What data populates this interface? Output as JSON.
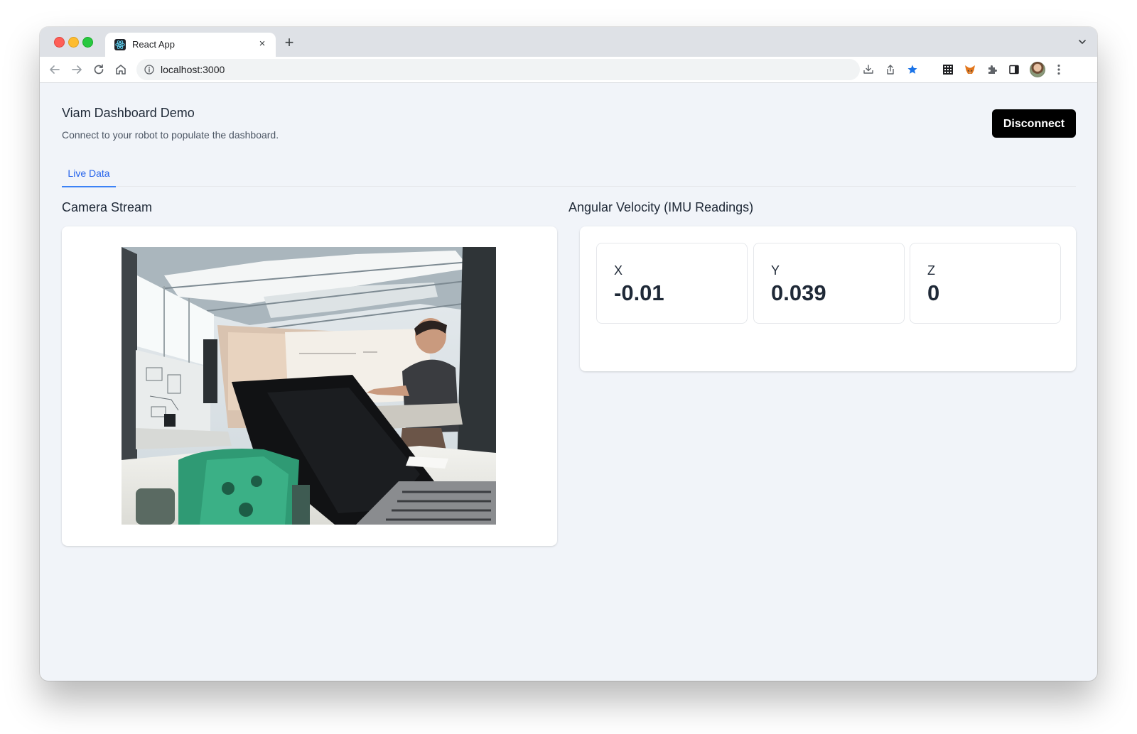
{
  "browser": {
    "tab_title": "React App",
    "tab_close": "×",
    "new_tab": "+",
    "url": "localhost:3000"
  },
  "header": {
    "title": "Viam Dashboard Demo",
    "subtitle": "Connect to your robot to populate the dashboard.",
    "disconnect_label": "Disconnect"
  },
  "tabs": [
    {
      "label": "Live Data",
      "active": true
    }
  ],
  "camera": {
    "title": "Camera Stream"
  },
  "imu": {
    "title": "Angular Velocity (IMU Readings)",
    "readings": [
      {
        "label": "X",
        "value": "-0.01"
      },
      {
        "label": "Y",
        "value": "0.039"
      },
      {
        "label": "Z",
        "value": "0"
      }
    ]
  },
  "colors": {
    "accent": "#2563eb",
    "page_background": "#f1f4f9",
    "button_background": "#000000"
  },
  "icons": [
    "react-favicon-icon",
    "close-icon",
    "plus-icon",
    "chevron-down-icon",
    "back-arrow-icon",
    "forward-arrow-icon",
    "reload-icon",
    "home-icon",
    "info-icon",
    "install-icon",
    "share-icon",
    "bookmark-star-icon",
    "qr-extension-icon",
    "metamask-fox-icon",
    "puzzle-extensions-icon",
    "side-panel-icon",
    "avatar",
    "kebab-menu-icon"
  ]
}
